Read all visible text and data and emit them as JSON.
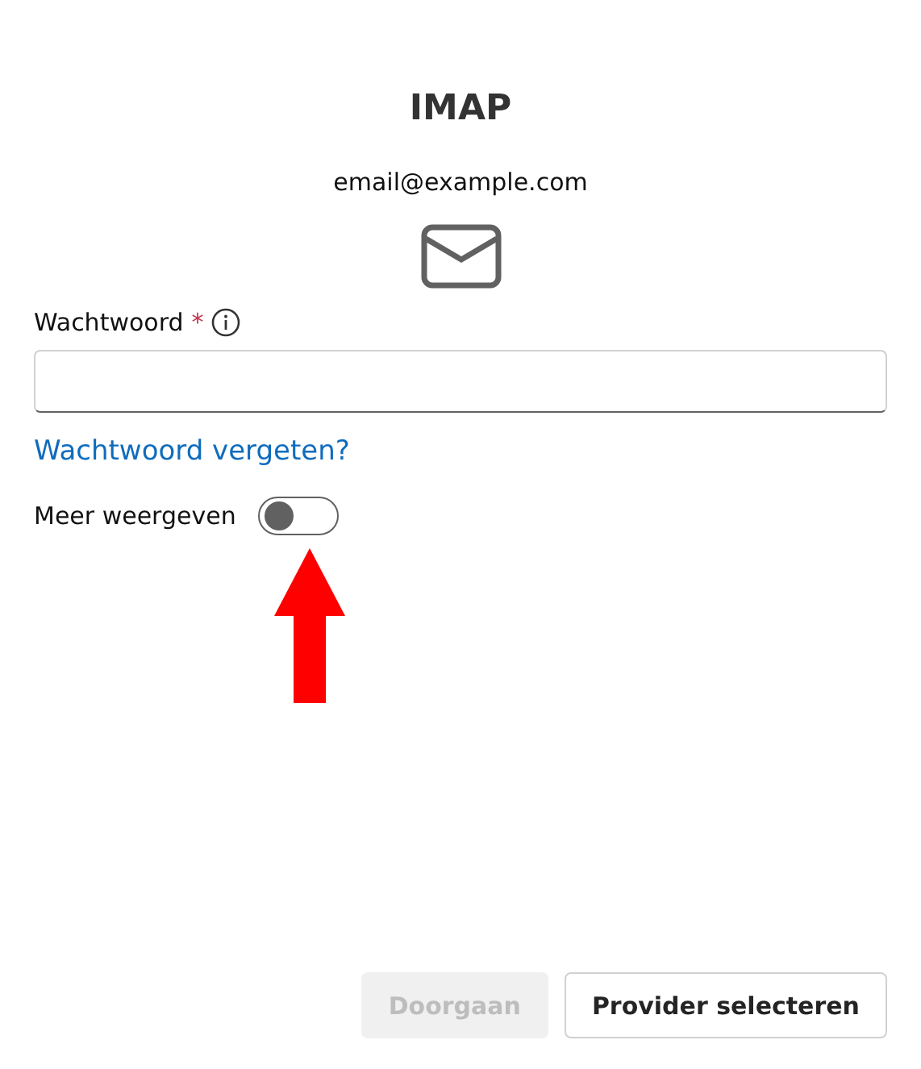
{
  "title": "IMAP",
  "email": "email@example.com",
  "password": {
    "label": "Wachtwoord",
    "required_mark": "*"
  },
  "forgot_link": "Wachtwoord vergeten?",
  "more_toggle": {
    "label": "Meer weergeven",
    "on": false
  },
  "buttons": [
    {
      "label": "Doorgaan",
      "disabled": true
    },
    {
      "label": "Provider selecteren",
      "disabled": false
    }
  ]
}
